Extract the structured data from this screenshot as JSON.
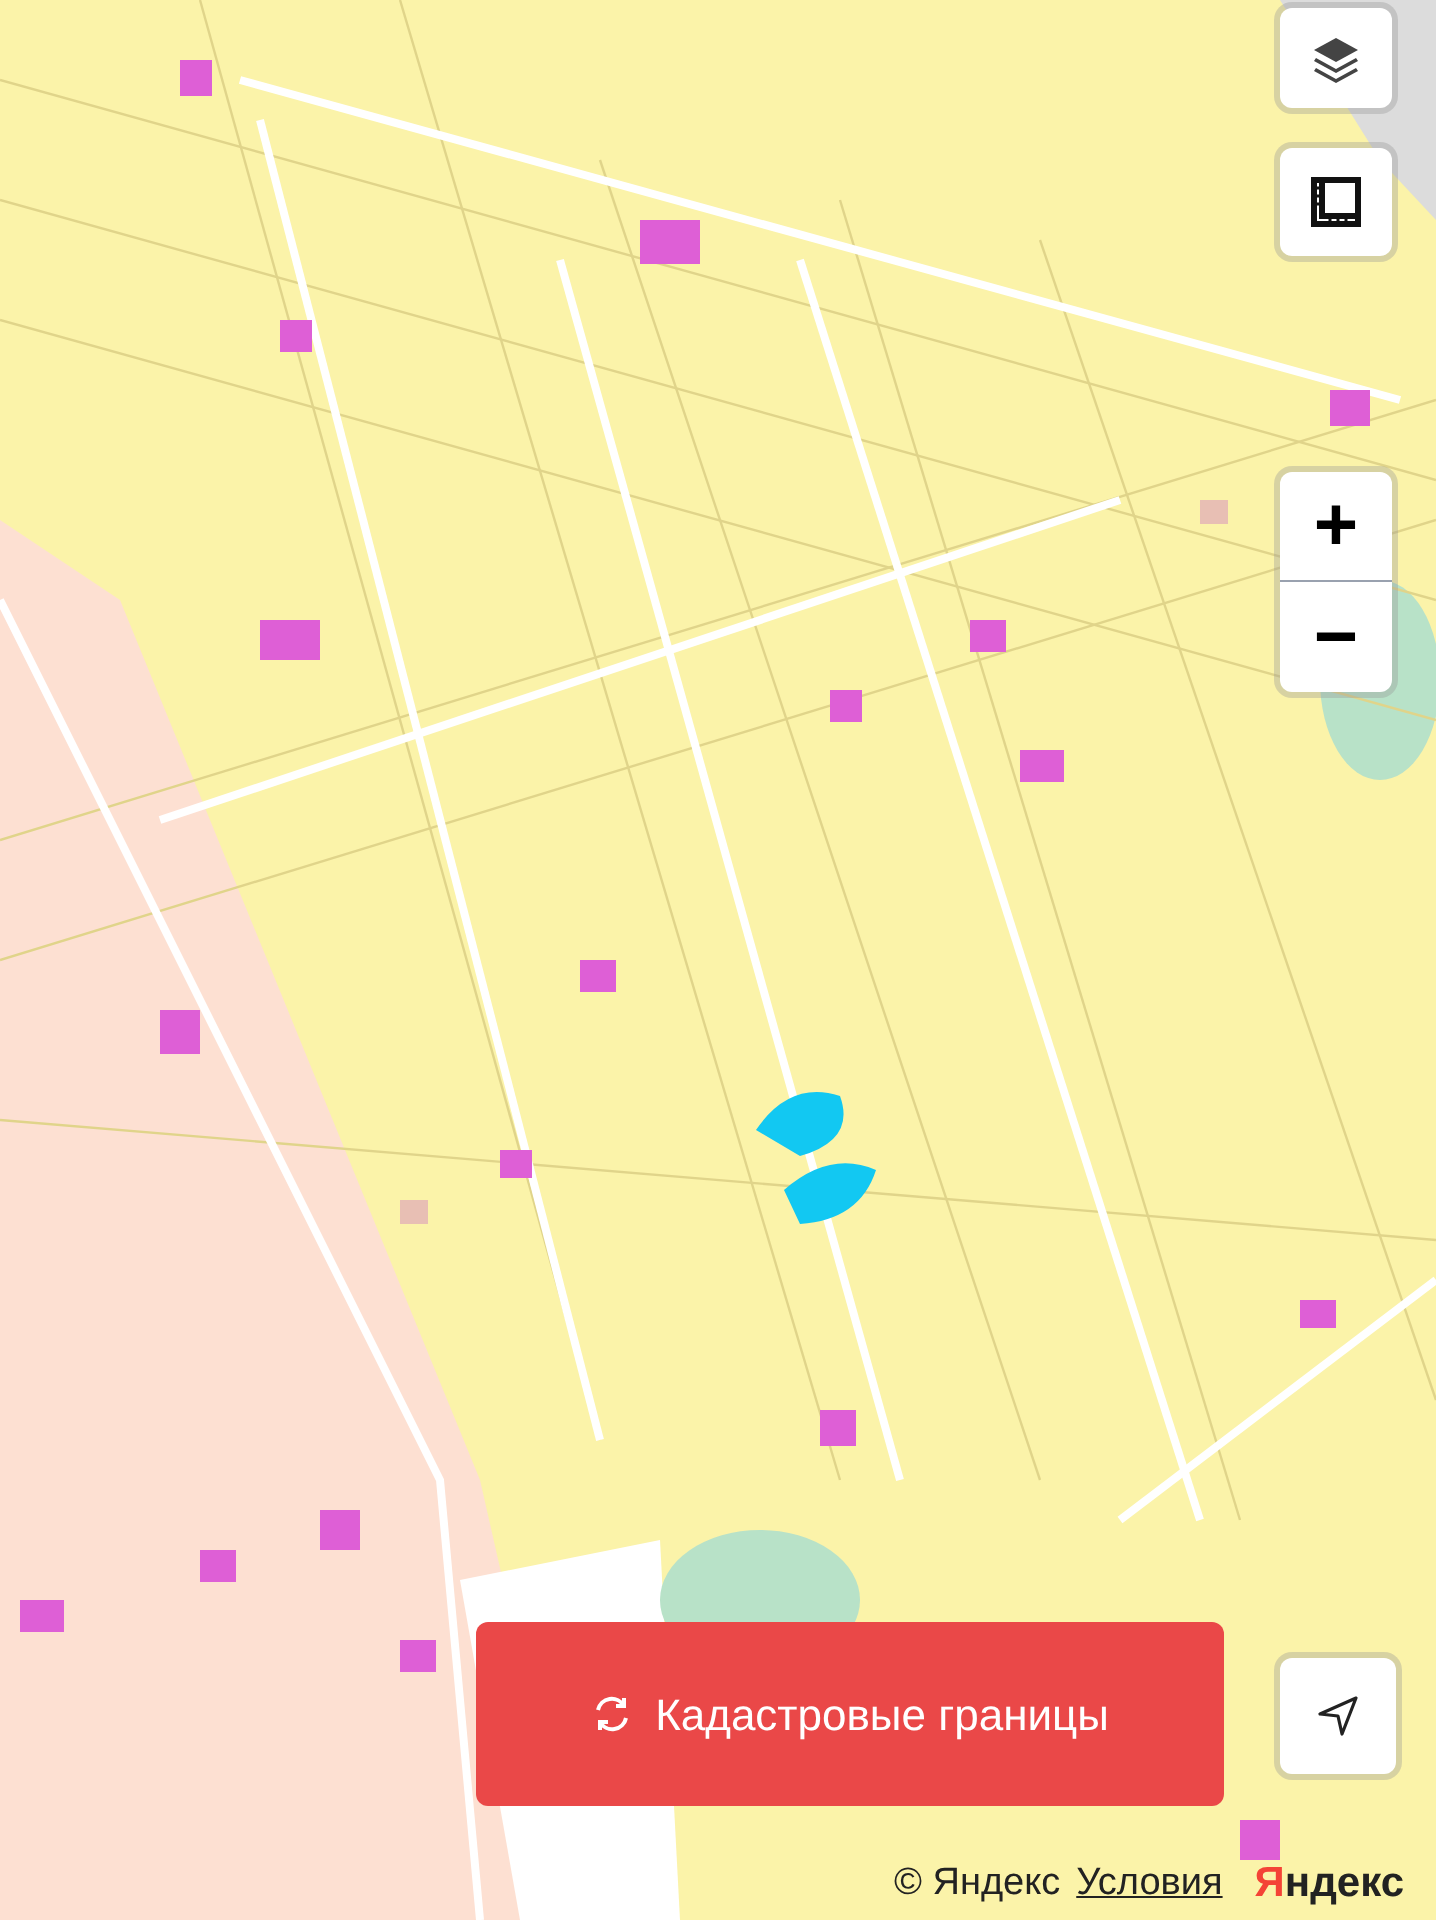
{
  "map_controls": {
    "zoom_in": "+",
    "zoom_out": "−"
  },
  "cadastre_button": {
    "label": "Кадастровые границы"
  },
  "attribution": {
    "copyright": "© Яндекс",
    "terms_link": "Условия",
    "logo": "Яндекс"
  }
}
